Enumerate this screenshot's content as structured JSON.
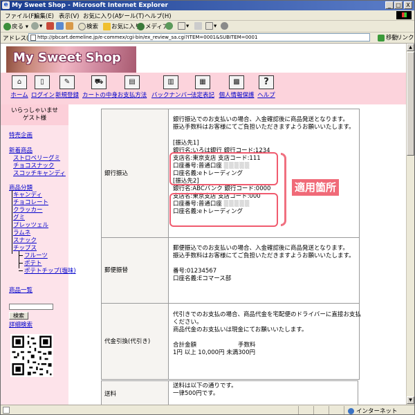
{
  "window": {
    "title": "My Sweet Shop - Microsoft Internet Explorer",
    "controls": [
      "_",
      "□",
      "X"
    ]
  },
  "menubar": {
    "items": [
      "ファイル(F)",
      "編集(E)",
      "表示(V)",
      "お気に入り(A)",
      "ツール(T)",
      "ヘルプ(H)"
    ]
  },
  "toolbar": {
    "back": "戻る",
    "search": "検索",
    "favorites": "お気に入り",
    "media": "メディア"
  },
  "address": {
    "label": "アドレス(D)",
    "url": "http://pbcart.demeline.jp/e-commex/cgi-bin/ex_review_sa.cgi?ITEM=0001&SUBITEM=0001",
    "go": "移動",
    "links": "リンク"
  },
  "status": {
    "zone": "インターネット"
  },
  "shop": {
    "title": "My Sweet Shop"
  },
  "nav": {
    "items": [
      {
        "label": "ホーム",
        "icon": "home-icon",
        "glyph": "⌂"
      },
      {
        "label": "ログイン",
        "icon": "door-icon",
        "glyph": "▯"
      },
      {
        "label": "新規登録",
        "icon": "pen-icon",
        "glyph": "✎"
      },
      {
        "label": "カートの中身",
        "icon": "cart-icon",
        "glyph": "⛟"
      },
      {
        "label": "お支払方法",
        "icon": "card-icon",
        "glyph": "▤"
      },
      {
        "label": "バックナンバー",
        "icon": "magazine-icon",
        "glyph": "▥"
      },
      {
        "label": "法定表記",
        "icon": "document-icon",
        "glyph": "▦"
      },
      {
        "label": "個人情報保護",
        "icon": "lock-icon",
        "glyph": "▩"
      },
      {
        "label": "ヘルプ",
        "icon": "help-icon",
        "glyph": "?"
      }
    ]
  },
  "sidebar": {
    "greeting_1": "いらっしゃいませ",
    "greeting_2": "ゲスト様",
    "special": "特売企画",
    "new_items": "新着商品",
    "new_list": [
      "ストロベリーグミ",
      "チョコスナック",
      "スコッチキャンディ"
    ],
    "category": "商品分類",
    "categories": [
      "キャンディ",
      "チョコレート",
      "クラッカー",
      "グミ",
      "プレッツェル",
      "ラムネ",
      "スナック",
      "チップス"
    ],
    "subcategories": [
      "フルーツ",
      "ポテト",
      "ポテトチップ(塩味)"
    ],
    "item_list": "商品一覧",
    "search_button": "検索",
    "advanced_search": "詳細検索"
  },
  "payment": {
    "bank": {
      "label": "銀行振込",
      "intro_1": "銀行振込でのお支払いの場合、入金確認後に商品発送となります。",
      "intro_2": "振込手数料はお客様にてご負担いただきますようお願いいたします。",
      "accounts": [
        {
          "header": "[振込先1]",
          "bank": "銀行名:いろは銀行  銀行コード:1234",
          "branch": "支店名:東京支店   支店コード:111",
          "number": "口座番号:普通口座",
          "holder": "口座名義:eトレーディング"
        },
        {
          "header": "[振込先2]",
          "bank": "銀行名:ABCバンク 銀行コード:0000",
          "branch": "支店名:東京支店   支店コード:000",
          "number": "口座番号:普通口座",
          "holder": "口座名義:eトレーディング"
        }
      ]
    },
    "callout": "適用箇所",
    "postal": {
      "label": "郵便振替",
      "line_1": "郵便振込でのお支払いの場合、入金確認後に商品発送となります。",
      "line_2": "振込手数料はお客様にてご負担いただきますようお願いいたします。",
      "number": "番号:01234567",
      "holder": "口座名義:Eコマース部"
    },
    "cod": {
      "label": "代金引換(代引き)",
      "line_1": "代引きでのお支払の場合、商品代金を宅配便のドライバーに直接お支払",
      "line_2": "ください。",
      "line_3": "商品代金のお支払いは現金にてお願いいたします。",
      "col_total": "合計金額",
      "col_fee": "手数料",
      "fee_row": "1円 以上 10,000円 未満300円"
    },
    "shipping": {
      "label": "送料",
      "line_1": "送料は以下の通りです。",
      "line_2": "一律500円です。"
    }
  }
}
